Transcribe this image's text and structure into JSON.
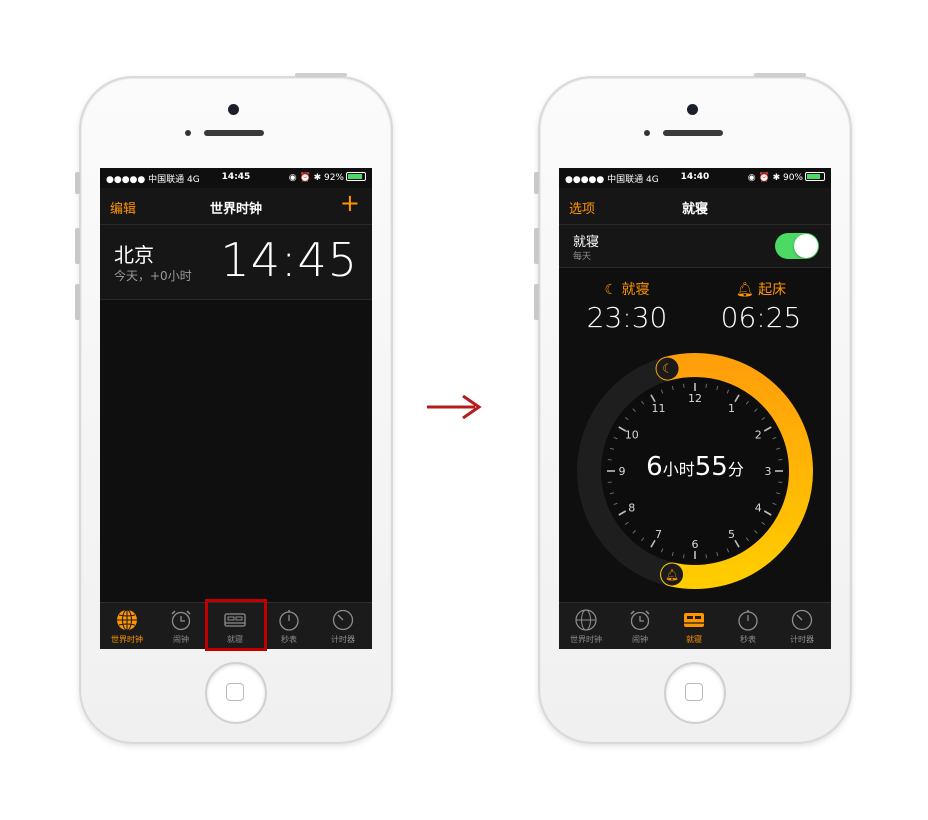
{
  "left_phone": {
    "status": {
      "carrier": "●●●●● 中国联通  4G",
      "time": "14:45",
      "battery": "92%"
    },
    "nav": {
      "left": "编辑",
      "title": "世界时钟",
      "plus": "+"
    },
    "city": {
      "name": "北京",
      "offset": "今天，+0小时",
      "time": "14:45"
    },
    "tabs": [
      {
        "label": "世界时钟",
        "icon": "globe-icon",
        "active": true
      },
      {
        "label": "闹钟",
        "icon": "alarm-clock-icon",
        "active": false
      },
      {
        "label": "就寝",
        "icon": "bed-icon",
        "active": false
      },
      {
        "label": "秒表",
        "icon": "stopwatch-icon",
        "active": false
      },
      {
        "label": "计时器",
        "icon": "timer-icon",
        "active": false
      }
    ]
  },
  "right_phone": {
    "status": {
      "carrier": "●●●●● 中国联通  4G",
      "time": "14:40",
      "battery": "90%"
    },
    "nav": {
      "left": "选项",
      "title": "就寝"
    },
    "toggle_row": {
      "title": "就寝",
      "subtitle": "每天",
      "on": true
    },
    "bedtime": {
      "label": "就寝",
      "time": "23:30"
    },
    "wake": {
      "label": "起床",
      "time": "06:25"
    },
    "dial": {
      "numbers": [
        "12",
        "1",
        "2",
        "3",
        "4",
        "5",
        "6",
        "7",
        "8",
        "9",
        "10",
        "11"
      ],
      "duration_hours": "6",
      "hours_unit": "小时",
      "duration_minutes": "55",
      "minutes_unit": "分"
    },
    "tabs": [
      {
        "label": "世界时钟",
        "icon": "globe-icon",
        "active": false
      },
      {
        "label": "闹钟",
        "icon": "alarm-clock-icon",
        "active": false
      },
      {
        "label": "就寝",
        "icon": "bed-icon",
        "active": true
      },
      {
        "label": "秒表",
        "icon": "stopwatch-icon",
        "active": false
      },
      {
        "label": "计时器",
        "icon": "timer-icon",
        "active": false
      }
    ]
  },
  "colors": {
    "accent": "#ff9500",
    "highlight": "#c00000",
    "toggle": "#4cd964",
    "arrow": "#b71c1c"
  }
}
